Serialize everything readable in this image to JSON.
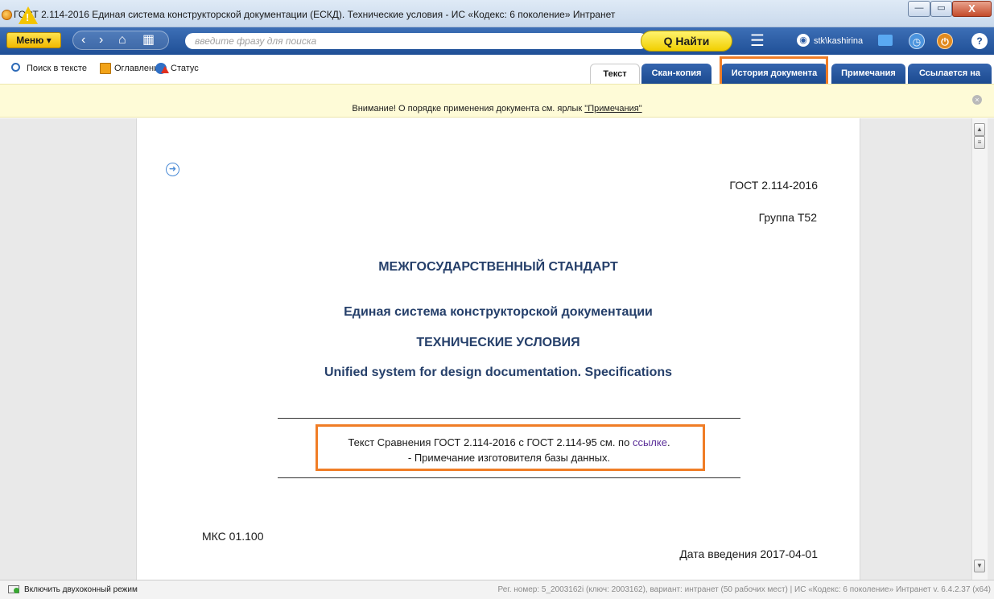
{
  "window": {
    "title": "ГОСТ 2.114-2016 Единая система конструкторской документации (ЕСКД). Технические условия - ИС «Кодекс: 6 поколение» Интранет",
    "minimize": "—",
    "maximize": "▭",
    "close": "X"
  },
  "toolbar": {
    "menu_label": "Меню ▾",
    "back_icon": "‹",
    "forward_icon": "›",
    "home_icon": "⌂",
    "grid_icon": "▦",
    "search_placeholder": "введите фразу для поиска",
    "find_label": "Q Найти",
    "hamburger_icon": "☰",
    "user_name": "stk\\kashirina",
    "help_icon": "?"
  },
  "subtoolbar": {
    "search_in_text": "Поиск в тексте",
    "contents": "Оглавление",
    "status": "Статус"
  },
  "tabs": [
    {
      "label": "Текст",
      "active": true
    },
    {
      "label": "Скан-копия",
      "active": false
    },
    {
      "label": "История документа",
      "active": false
    },
    {
      "label": "Примечания",
      "active": false
    },
    {
      "label": "Ссылается на",
      "active": false
    }
  ],
  "notice": {
    "text": "Внимание! О порядке применения документа см. ярлык ",
    "link": "\"Примечания\"",
    "warn_icon": "!",
    "close_icon": "×"
  },
  "document": {
    "designation": "ГОСТ 2.114-2016",
    "group": "Группа Т52",
    "heading": "МЕЖГОСУДАРСТВЕННЫЙ СТАНДАРТ",
    "system_title": "Единая система конструкторской документации",
    "subject": "ТЕХНИЧЕСКИЕ УСЛОВИЯ",
    "english_title": "Unified system for design documentation. Specifications",
    "note_prefix": "Текст Сравнения ГОСТ 2.114-2016 с ГОСТ 2.114-95 см. по ",
    "note_link": "ссылке",
    "note_suffix": ".",
    "note_source": "- Примечание изготовителя базы данных.",
    "mks": "МКС 01.100",
    "intro_date": "Дата введения 2017-04-01",
    "arrow_icon": "➜"
  },
  "statusbar": {
    "dual_mode": "Включить двухоконный режим",
    "info": "Рег. номер: 5_2003162i (ключ: 2003162), вариант: интранет (50 рабочих мест)   |   ИС «Кодекс: 6 поколение» Интранет v. 6.4.2.37 (x64)"
  },
  "colors": {
    "toolbar": "#1f4f96",
    "accent_yellow": "#f1cf00",
    "highlight": "#f07d26",
    "heading_text": "#253f6a"
  }
}
